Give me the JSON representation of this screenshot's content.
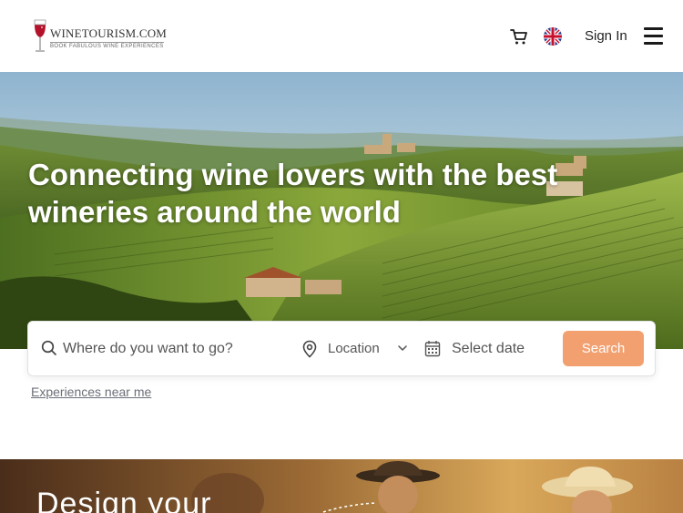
{
  "header": {
    "logo": {
      "name": "WINETOURISM.COM",
      "tagline": "BOOK FABULOUS WINE EXPERIENCES"
    },
    "icons": {
      "cart": "cart-icon",
      "language": "uk-flag-icon",
      "menu": "hamburger-menu-icon"
    },
    "signin_label": "Sign In"
  },
  "hero": {
    "title": "Connecting wine lovers with the best wineries around the world"
  },
  "search": {
    "where_placeholder": "Where do you want to go?",
    "location_label": "Location",
    "date_label": "Select date",
    "button_label": "Search",
    "button_color": "#f2a06f"
  },
  "near_me_link": "Experiences near me",
  "section": {
    "title": "Design your"
  }
}
